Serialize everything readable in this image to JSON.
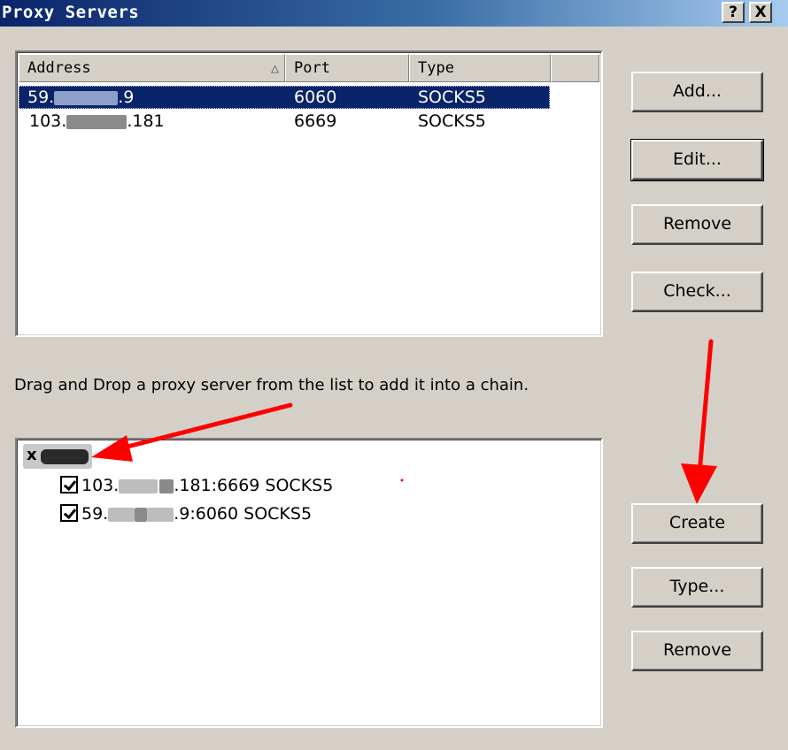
{
  "window": {
    "title": "Proxy Servers",
    "help_label": "?",
    "close_label": "X"
  },
  "proxy_list": {
    "columns": [
      "Address",
      "Port",
      "Type"
    ],
    "sort_indicator": "△",
    "rows": [
      {
        "address_start": "59.",
        "address_end": ".9",
        "port": "6060",
        "type": "SOCKS5",
        "selected": true
      },
      {
        "address_start": "103.",
        "address_end": ".181",
        "port": "6669",
        "type": "SOCKS5",
        "selected": false
      }
    ]
  },
  "buttons": {
    "add": "Add...",
    "edit": "Edit...",
    "remove": "Remove",
    "check": "Check...",
    "create": "Create",
    "type": "Type...",
    "remove_chain": "Remove"
  },
  "hint_text": "Drag and Drop a proxy server from the list to add it into a chain.",
  "chain": {
    "root_prefix": "x",
    "items": [
      {
        "start": "103.",
        "end": ".181:6669 SOCKS5",
        "checked": true
      },
      {
        "start": "59.",
        "end": ".9:6060 SOCKS5",
        "checked": true
      }
    ]
  },
  "colors": {
    "titlebar_start": "#0a246a",
    "selection": "#0a246a",
    "annotation_arrow": "#ff0000",
    "dialog_bg": "#d4d0c8"
  }
}
